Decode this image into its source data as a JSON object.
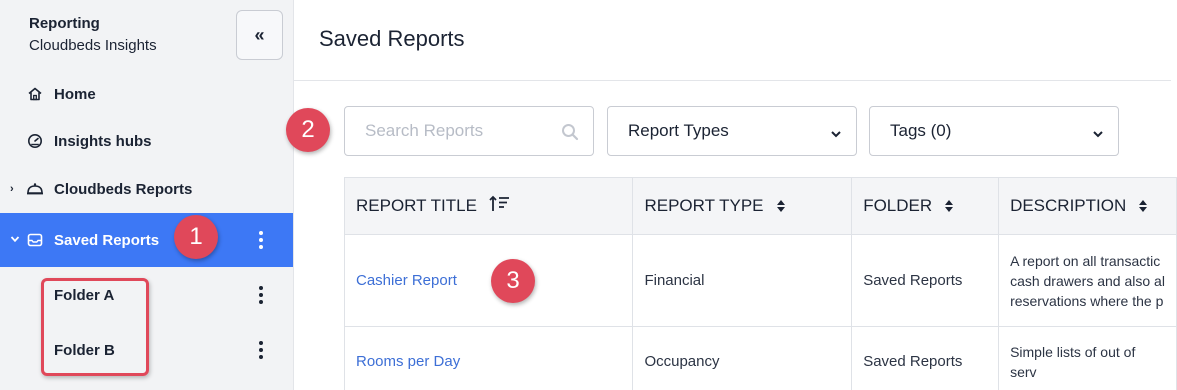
{
  "sidebar": {
    "app_title": "Reporting",
    "app_subtitle": "Cloudbeds Insights",
    "collapse_label": "«",
    "items": [
      {
        "label": "Home",
        "icon": "home-icon"
      },
      {
        "label": "Insights hubs",
        "icon": "gauge-icon"
      },
      {
        "label": "Cloudbeds Reports",
        "icon": "bell-icon",
        "chevron": "›"
      },
      {
        "label": "Saved Reports",
        "icon": "inbox-icon",
        "chevron": "⌄",
        "active": true
      }
    ],
    "folders": [
      {
        "label": "Folder A"
      },
      {
        "label": "Folder B"
      }
    ]
  },
  "main": {
    "title": "Saved Reports",
    "search_placeholder": "Search Reports",
    "report_types_label": "Report Types",
    "tags_label": "Tags (0)"
  },
  "table": {
    "headers": [
      "REPORT TITLE",
      "REPORT TYPE",
      "FOLDER",
      "DESCRIPTION"
    ],
    "rows": [
      {
        "title": "Cashier Report",
        "type": "Financial",
        "folder": "Saved Reports",
        "description": [
          "A report on all transactic",
          "cash drawers and also al",
          "reservations where the p"
        ]
      },
      {
        "title": "Rooms per Day",
        "type": "Occupancy",
        "folder": "Saved Reports",
        "description": [
          "Simple lists of out of serv"
        ]
      }
    ]
  },
  "callouts": [
    "1",
    "2",
    "3"
  ],
  "colors": {
    "accent": "#3d78f5",
    "callout": "#e0485a",
    "link": "#3d6fd6"
  }
}
